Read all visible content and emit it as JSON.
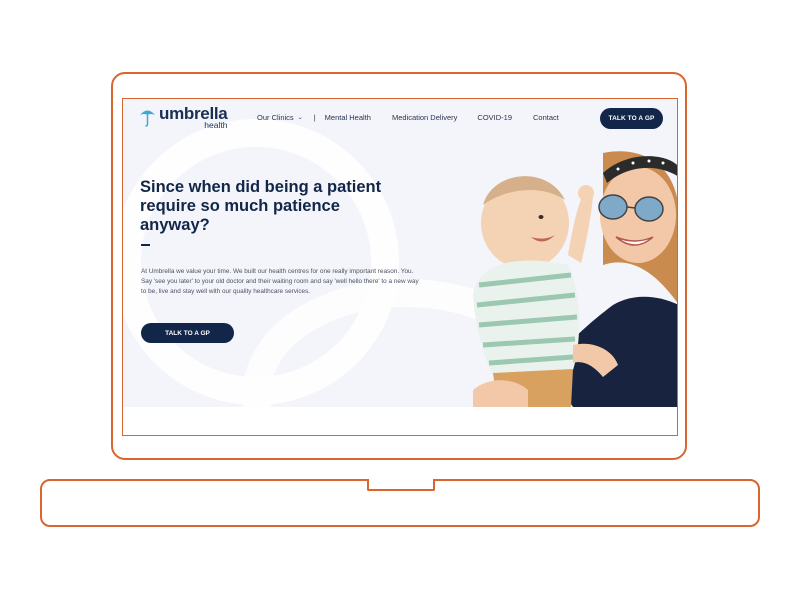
{
  "colors": {
    "frame": "#d9652f",
    "navy": "#12264a",
    "hero_bg": "#f3f5fa",
    "logo_accent": "#3fa9d6"
  },
  "nav": {
    "logo_main": "umbrella",
    "logo_sub": "health",
    "links": [
      "Our Clinics",
      "Mental Health",
      "Medication Delivery",
      "COVID-19",
      "Contact"
    ],
    "divider": "|",
    "cta": "TALK TO A GP"
  },
  "hero": {
    "headline": "Since when did being a patient require so much patience anyway?",
    "dash": "—",
    "body": "At Umbrella we value your time. We built our health centres for one really important reason. You. Say 'see you later' to your old doctor and their waiting room and say 'well hello there' to a new way to be, live and stay well with our quality healthcare services.",
    "cta": "TALK TO A GP"
  },
  "icons": {
    "logo": "umbrella-icon",
    "clinics_dropdown": "chevron-down-icon"
  }
}
